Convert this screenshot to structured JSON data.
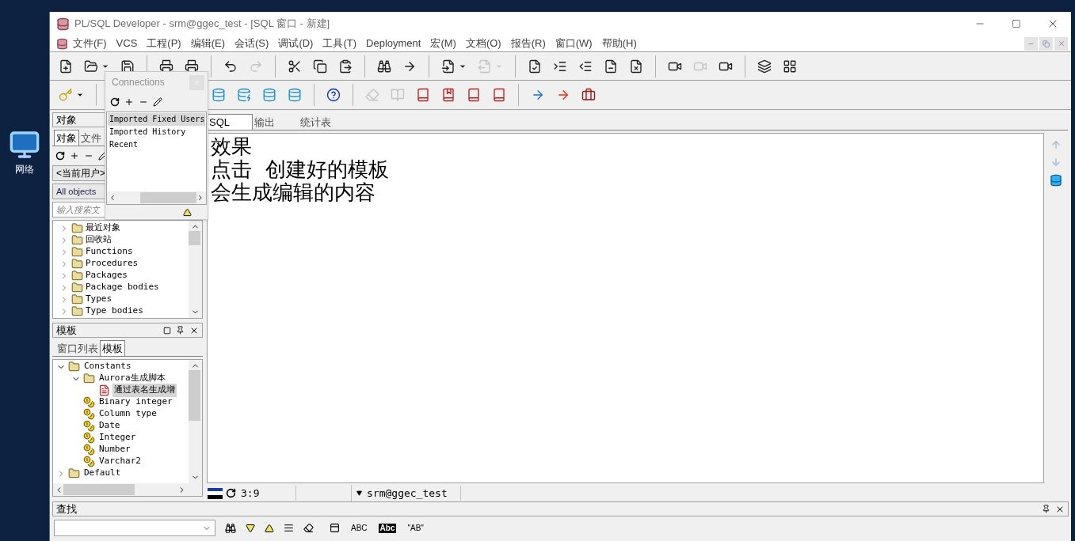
{
  "desktop_icons": [
    {
      "label": "网络"
    }
  ],
  "app_window": {
    "title": "PL/SQL Developer - srm@ggec_test - [SQL 窗口 - 新建]"
  },
  "menu": [
    "文件(F)",
    "VCS",
    "工程(P)",
    "编辑(E)",
    "会话(S)",
    "调试(D)",
    "工具(T)",
    "Deployment",
    "宏(M)",
    "文档(O)",
    "报告(R)",
    "窗口(W)",
    "帮助(H)"
  ],
  "toolbar_1": [
    [
      {
        "disabled": false
      },
      {
        "disabled": false,
        "dropdown": true
      },
      {
        "disabled": false
      }
    ],
    [
      {
        "disabled": false
      },
      {
        "disabled": false
      }
    ],
    [
      {
        "disabled": false
      },
      {
        "disabled": true
      }
    ],
    [
      {
        "disabled": false
      },
      {
        "disabled": false
      },
      {
        "disabled": false
      }
    ],
    [
      {
        "disabled": false
      },
      {
        "disabled": false
      }
    ],
    [
      {
        "disabled": false,
        "dropdown": true
      },
      {
        "disabled": true,
        "dropdown": true
      }
    ],
    [
      {
        "disabled": false
      },
      {
        "disabled": false
      },
      {
        "disabled": false
      },
      {
        "disabled": false
      },
      {
        "disabled": false
      }
    ],
    [
      {
        "disabled": false
      },
      {
        "disabled": true
      },
      {
        "disabled": false
      }
    ],
    [
      {
        "disabled": false
      },
      {
        "disabled": false
      }
    ]
  ],
  "toolbar_2": [
    [
      {
        "disabled": false,
        "dropdown": true
      }
    ],
    [
      {
        "disabled": false
      },
      {
        "disabled": false
      },
      {
        "disabled": false
      },
      {
        "disabled": false
      }
    ],
    [
      {
        "disabled": false
      }
    ],
    [
      {
        "disabled": true
      },
      {
        "disabled": true
      },
      {
        "disabled": false
      },
      {
        "disabled": false
      },
      {
        "disabled": false
      },
      {
        "disabled": false
      }
    ],
    [
      {
        "disabled": false
      },
      {
        "disabled": false
      },
      {
        "disabled": false
      }
    ]
  ],
  "connections_popup": {
    "title": "Connections",
    "items": [
      {
        "label": "Imported Fixed Users",
        "selected": true
      },
      {
        "label": "Imported History",
        "selected": false
      },
      {
        "label": "Recent",
        "selected": false
      }
    ]
  },
  "object_panel": {
    "title": "对象",
    "tabs": [
      {
        "label": "对象",
        "selected": true
      },
      {
        "label": "文件",
        "selected": false
      }
    ],
    "user_combo": "<当前用户>",
    "filter_combo": "All objects",
    "search": {
      "placeholder": "输入搜索文"
    },
    "tree": [
      {
        "label": "最近对象",
        "expanded": false
      },
      {
        "label": "回收站",
        "expanded": false
      },
      {
        "label": "Functions",
        "expanded": false
      },
      {
        "label": "Procedures",
        "expanded": false
      },
      {
        "label": "Packages",
        "expanded": false
      },
      {
        "label": "Package bodies",
        "expanded": false
      },
      {
        "label": "Types",
        "expanded": false
      },
      {
        "label": "Type bodies",
        "expanded": false
      }
    ]
  },
  "template_panel": {
    "title": "模板",
    "tabs": [
      {
        "label": "窗口列表",
        "selected": false
      },
      {
        "label": "模板",
        "selected": true
      }
    ],
    "tree": [
      {
        "label": "Constants",
        "kind": "folder",
        "expanded": true,
        "selected": false,
        "children": [
          {
            "label": "Aurora生成脚本",
            "kind": "folder",
            "expanded": true,
            "selected": false,
            "children": [
              {
                "label": "通过表名生成增",
                "kind": "template",
                "selected": true
              }
            ]
          },
          {
            "label": "Binary integer",
            "kind": "constant",
            "selected": false
          },
          {
            "label": "Column type",
            "kind": "constant",
            "selected": false
          },
          {
            "label": "Date",
            "kind": "constant",
            "selected": false
          },
          {
            "label": "Integer",
            "kind": "constant",
            "selected": false
          },
          {
            "label": "Number",
            "kind": "constant",
            "selected": false
          },
          {
            "label": "Varchar2",
            "kind": "constant",
            "selected": false
          }
        ]
      },
      {
        "label": "Default",
        "kind": "folder",
        "expanded": false,
        "selected": false
      }
    ]
  },
  "editor": {
    "tabs": [
      {
        "label": "SQL",
        "selected": true
      },
      {
        "label": "输出",
        "selected": false
      },
      {
        "label": "统计表",
        "selected": false
      }
    ],
    "lines": [
      "效果",
      "点击  创建好的模板",
      "会生成编辑的内容"
    ]
  },
  "status_bar": {
    "cursor": "3:9",
    "connection": "srm@ggec_test"
  },
  "find_panel": {
    "title": "查找",
    "options": [
      {
        "label": "ABC",
        "kind": "plain"
      },
      {
        "label": "Abc",
        "kind": "inverted"
      },
      {
        "label": "\"AB\"",
        "kind": "plain"
      }
    ]
  }
}
